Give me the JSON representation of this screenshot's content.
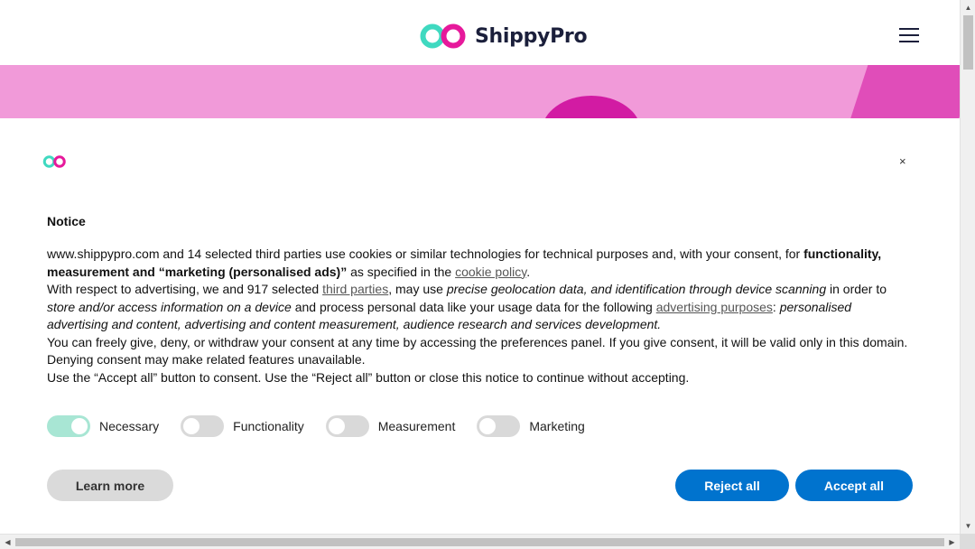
{
  "header": {
    "brand_name": "ShippyPro",
    "logo_icon": "infinity-logo-icon",
    "menu_icon": "hamburger-menu-icon"
  },
  "colors": {
    "brand_teal": "#3fd9c0",
    "brand_pink": "#e6199b",
    "hero_pink": "#f19ad9",
    "button_blue": "#0073ce",
    "toggle_on": "#a8e6d4"
  },
  "notice": {
    "close_label": "×",
    "title": "Notice",
    "p1_a": "www.shippypro.com and 14 selected third parties use cookies or similar technologies for technical purposes and, with your consent, for ",
    "p1_b": "functionality, measurement and “marketing (personalised ads)”",
    "p1_c": " as specified in the ",
    "p1_link": "cookie policy",
    "p1_d": ".",
    "p2_a": "With respect to advertising, we and 917 selected ",
    "p2_link1": "third parties",
    "p2_b": ", may use ",
    "p2_i1": "precise geolocation data, and identification through device scanning",
    "p2_c": " in order to ",
    "p2_i2": "store and/or access information on a device",
    "p2_d": " and process personal data like your usage data for the following ",
    "p2_link2": "advertising purposes",
    "p2_e": ": ",
    "p2_i3": "personalised advertising and content, advertising and content measurement, audience research and services development.",
    "p3": "You can freely give, deny, or withdraw your consent at any time by accessing the preferences panel. If you give consent, it will be valid only in this domain. Denying consent may make related features unavailable.",
    "p4": "Use the “Accept all” button to consent. Use the “Reject all” button or close this notice to continue without accepting."
  },
  "toggles": [
    {
      "label": "Necessary",
      "on": true
    },
    {
      "label": "Functionality",
      "on": false
    },
    {
      "label": "Measurement",
      "on": false
    },
    {
      "label": "Marketing",
      "on": false
    }
  ],
  "buttons": {
    "learn_more": "Learn more",
    "reject_all": "Reject all",
    "accept_all": "Accept all"
  },
  "scrollbar": {
    "up": "▲",
    "down": "▼",
    "left": "◀",
    "right": "▶"
  }
}
